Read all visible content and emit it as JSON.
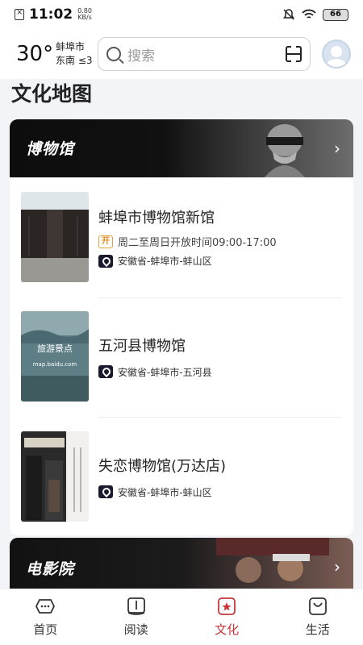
{
  "status_bar": {
    "time": "11:02",
    "speed_value": "0.80",
    "speed_unit": "KB/s",
    "battery": "66"
  },
  "header": {
    "temperature": "30°",
    "city": "蚌埠市",
    "wind": "东南 ≤3",
    "search_placeholder": "搜索"
  },
  "page_title": "文化地图",
  "museum_section": {
    "label": "博物馆",
    "items": [
      {
        "name": "蚌埠市博物馆新馆",
        "open_badge": "开",
        "hours": "周二至周日开放时间09:00-17:00",
        "address": "安徽省-蚌埠市-蚌山区"
      },
      {
        "name": "五河县博物馆",
        "address": "安徽省-蚌埠市-五河县",
        "thumb_text": "旅游景点",
        "thumb_sub": "map.baidu.com"
      },
      {
        "name": "失恋博物馆(万达店)",
        "address": "安徽省-蚌埠市-蚌山区"
      }
    ]
  },
  "cinema_section": {
    "label": "电影院"
  },
  "bottom_nav": [
    {
      "label": "首页",
      "icon": "home-icon"
    },
    {
      "label": "阅读",
      "icon": "book-icon"
    },
    {
      "label": "文化",
      "icon": "culture-icon",
      "active": true
    },
    {
      "label": "生活",
      "icon": "bag-icon"
    }
  ],
  "colors": {
    "accent": "#c5363a",
    "banner_dark": "#111111"
  }
}
